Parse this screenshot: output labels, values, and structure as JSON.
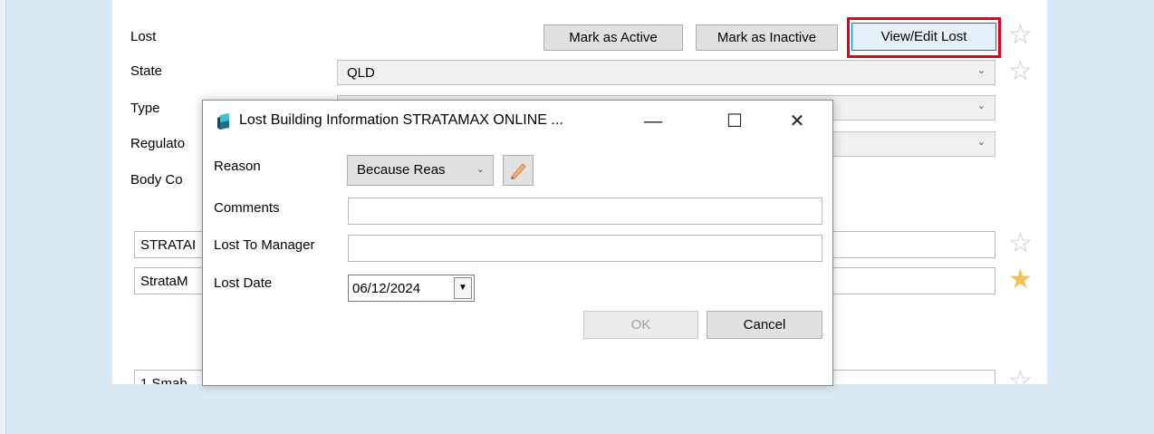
{
  "form": {
    "labels": {
      "lost": "Lost",
      "state": "State",
      "type": "Type",
      "regulator": "Regulato",
      "body_corporate": "Body Co"
    },
    "buttons": {
      "mark_active": "Mark as Active",
      "mark_inactive": "Mark as Inactive",
      "view_edit_lost": "View/Edit Lost"
    },
    "state_value": "QLD",
    "field1_value": "STRATAI",
    "field2_value": "StrataM",
    "field3_value": "1 Smab"
  },
  "dialog": {
    "title": "Lost Building Information STRATAMAX ONLINE ...",
    "controls": {
      "minimize": "—",
      "maximize": "☐",
      "close": "✕"
    },
    "labels": {
      "reason": "Reason",
      "comments": "Comments",
      "lost_to_manager": "Lost To Manager",
      "lost_date": "Lost Date"
    },
    "reason_value": "Because Reas",
    "comments_value": "",
    "lost_to_manager_value": "",
    "lost_date_value": "06/12/2024",
    "ok_label": "OK",
    "cancel_label": "Cancel"
  },
  "icons": {
    "star": "star-icon",
    "favorite_star": "star-filled-icon",
    "app": "stratamax-app-icon",
    "edit": "pencil-icon",
    "chevron": "chevron-down-icon",
    "calendar_drop": "dropdown-arrow-icon"
  },
  "colors": {
    "highlight": "#e0001a",
    "background": "#daeaf5",
    "star_filled": "#f2c15a",
    "star_empty": "#c8c8c8"
  }
}
